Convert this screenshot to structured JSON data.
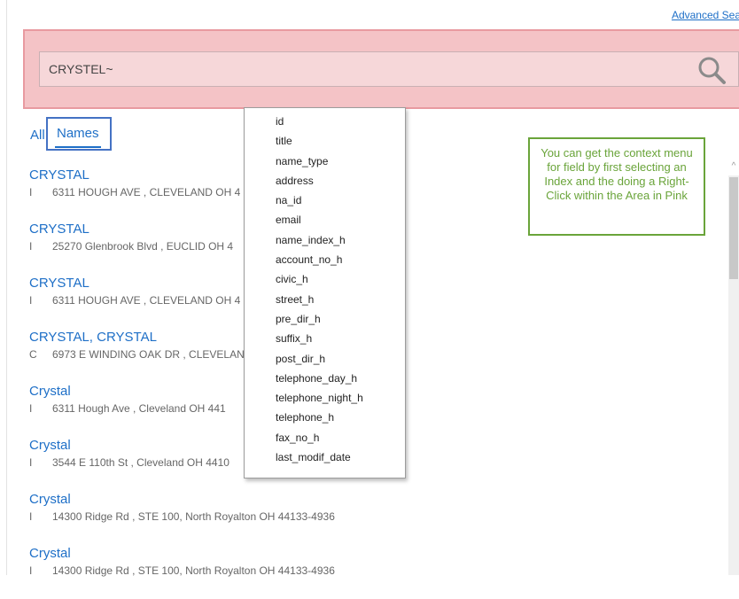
{
  "header": {
    "advanced_search_link": "Advanced Searc"
  },
  "search": {
    "value": "CRYSTEL~",
    "area_color": "#f4c3c6"
  },
  "tabs": {
    "all": "All",
    "names": "Names"
  },
  "results": [
    {
      "name": "CRYSTAL",
      "type": "I",
      "address": "6311  HOUGH AVE , CLEVELAND OH  4"
    },
    {
      "name": "CRYSTAL",
      "type": "I",
      "address": "25270  Glenbrook Blvd , EUCLID OH  4"
    },
    {
      "name": "CRYSTAL",
      "type": "I",
      "address": "6311  HOUGH AVE , CLEVELAND OH  4"
    },
    {
      "name": "CRYSTAL, CRYSTAL",
      "type": "C",
      "address": "6973  E WINDING OAK DR , CLEVELAN"
    },
    {
      "name": "Crystal",
      "type": "I",
      "address": "6311  Hough Ave , Cleveland OH  441"
    },
    {
      "name": "Crystal",
      "type": "I",
      "address": "3544  E 110th St , Cleveland OH  4410"
    },
    {
      "name": "Crystal",
      "type": "I",
      "address": "14300  Ridge Rd , STE 100, North Royalton OH  44133-4936"
    },
    {
      "name": "Crystal",
      "type": "I",
      "address": "14300  Ridge Rd , STE 100, North Royalton OH  44133-4936"
    }
  ],
  "context_menu": {
    "items": [
      "id",
      "title",
      "name_type",
      "address",
      "na_id",
      "email",
      "name_index_h",
      "account_no_h",
      "civic_h",
      "street_h",
      "pre_dir_h",
      "suffix_h",
      "post_dir_h",
      "telephone_day_h",
      "telephone_night_h",
      "telephone_h",
      "fax_no_h",
      "last_modif_date"
    ]
  },
  "callout": {
    "text": "You can get the context menu for field by first selecting an Index and the doing a Right-Click within the Area in Pink"
  },
  "colors": {
    "link": "#1e6fc7",
    "callout": "#6aa43a",
    "tab_highlight": "#4472c4"
  },
  "icons": {
    "search": "search-icon",
    "scroll_up": "chevron-up-icon"
  }
}
